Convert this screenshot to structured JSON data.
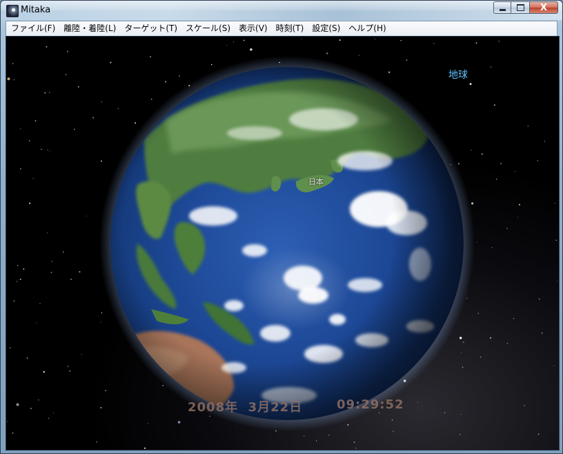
{
  "window": {
    "title": "Mitaka",
    "controls": {
      "minimize": "minimize",
      "maximize": "maximize",
      "close": "X"
    }
  },
  "menu": [
    "ファイル(F)",
    "離陸・着陸(L)",
    "ターゲット(T)",
    "スケール(S)",
    "表示(V)",
    "時刻(T)",
    "設定(S)",
    "ヘルプ(H)"
  ],
  "view": {
    "target_label": "地球",
    "region_label": "日本",
    "date": "2008年  3月22日",
    "time": "09:29:52",
    "colors": {
      "target_label": "#5fc0ff",
      "datetime": "#8f6f64",
      "space": "#000000",
      "ocean": "#1b3f86"
    }
  },
  "icons": {
    "app": "mitaka-app-icon",
    "minimize": "minimize-icon",
    "maximize": "maximize-icon",
    "close": "close-icon"
  }
}
